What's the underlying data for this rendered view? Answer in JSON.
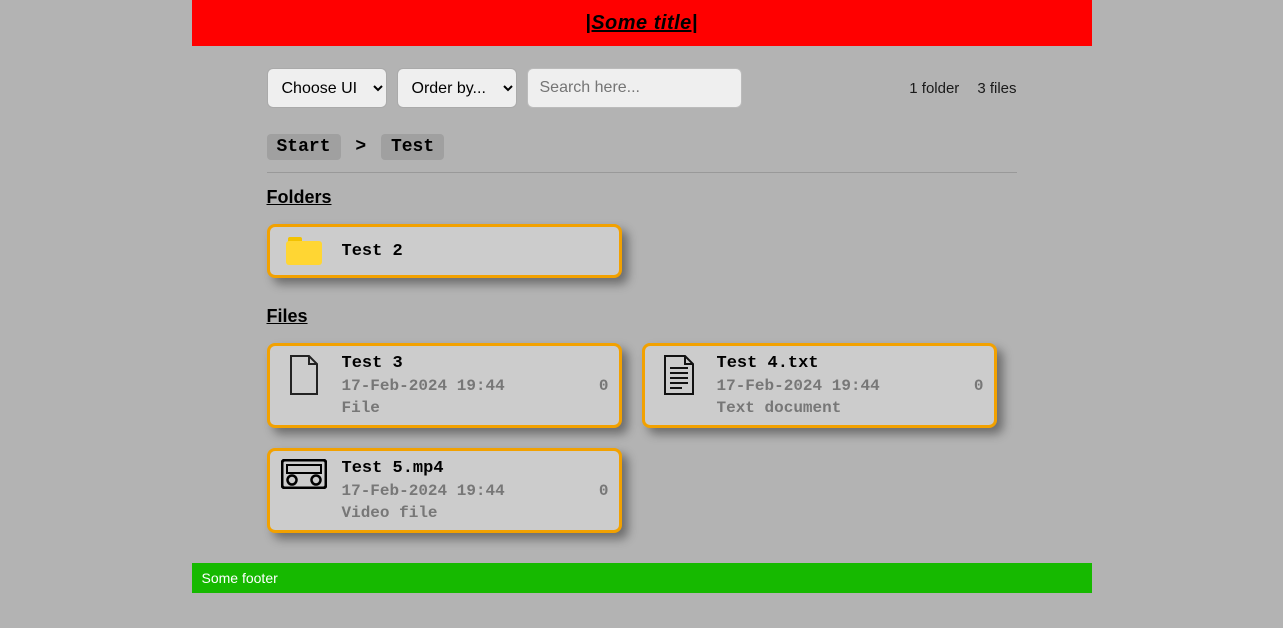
{
  "header": {
    "title": "|Some title|"
  },
  "toolbar": {
    "choose_ui_label": "Choose UI",
    "order_by_label": "Order by...",
    "search_placeholder": "Search here..."
  },
  "counts": {
    "folders": "1 folder",
    "files": "3 files"
  },
  "breadcrumb": {
    "items": [
      "Start",
      "Test"
    ],
    "sep": ">"
  },
  "sections": {
    "folders_heading": "Folders",
    "files_heading": "Files"
  },
  "folders": [
    {
      "name": "Test 2"
    }
  ],
  "files": [
    {
      "name": "Test 3",
      "date": "17-Feb-2024 19:44",
      "size": "0",
      "type": "File",
      "icon": "file-generic"
    },
    {
      "name": "Test 4.txt",
      "date": "17-Feb-2024 19:44",
      "size": "0",
      "type": "Text document",
      "icon": "file-text"
    },
    {
      "name": "Test 5.mp4",
      "date": "17-Feb-2024 19:44",
      "size": "0",
      "type": "Video file",
      "icon": "file-video"
    }
  ],
  "footer": {
    "text": "Some footer"
  }
}
